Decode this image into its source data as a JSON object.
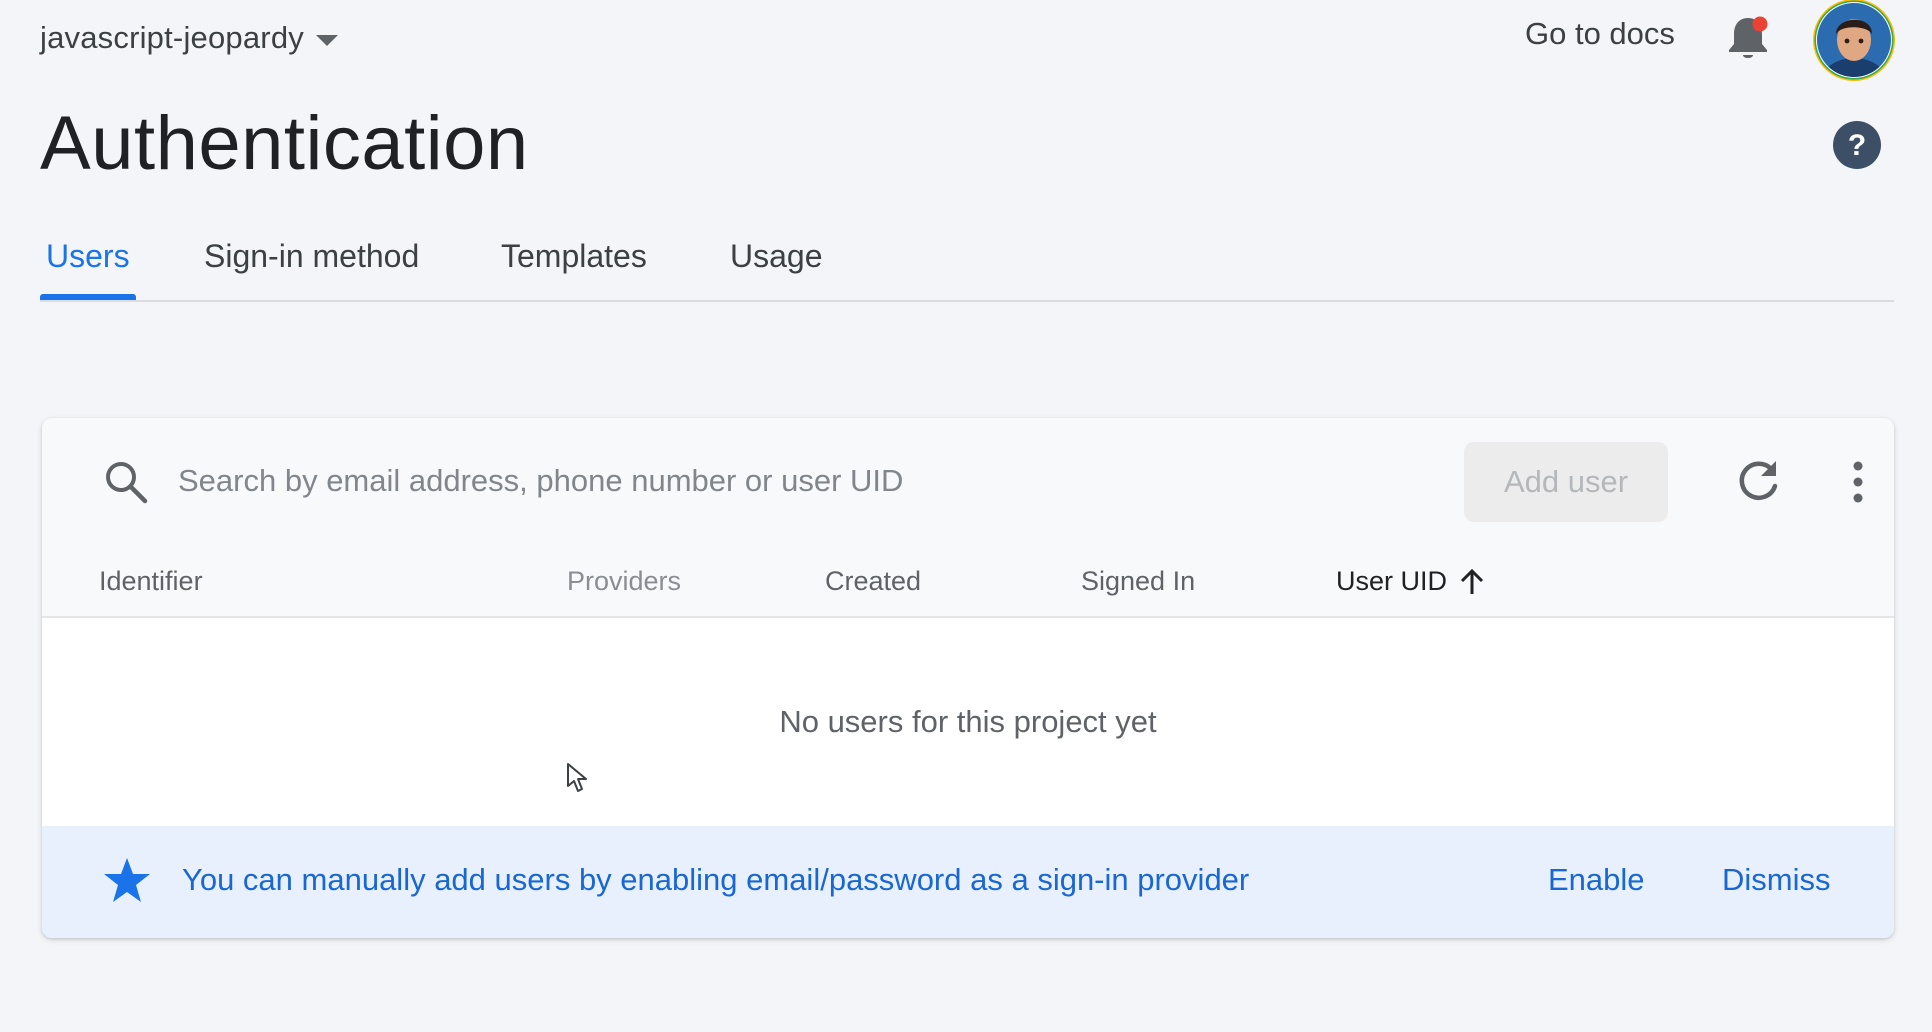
{
  "header": {
    "project_name": "javascript-jeopardy",
    "go_to_docs": "Go to docs",
    "notification_badge_color": "#ea4335"
  },
  "page": {
    "title": "Authentication"
  },
  "tabs": [
    {
      "label": "Users",
      "active": true
    },
    {
      "label": "Sign-in method",
      "active": false
    },
    {
      "label": "Templates",
      "active": false
    },
    {
      "label": "Usage",
      "active": false
    }
  ],
  "users_table": {
    "search": {
      "placeholder": "Search by email address, phone number or user UID",
      "value": ""
    },
    "add_user_label": "Add user",
    "columns": {
      "identifier": "Identifier",
      "providers": "Providers",
      "created": "Created",
      "signed_in": "Signed In",
      "user_uid": "User UID"
    },
    "sort": {
      "column": "User UID",
      "direction": "ascending"
    },
    "empty_message": "No users for this project yet"
  },
  "banner": {
    "message": "You can manually add users by enabling email/password as a sign-in provider",
    "enable_label": "Enable",
    "dismiss_label": "Dismiss"
  },
  "colors": {
    "accent": "#1a73e8",
    "banner_bg": "#e8f0fe",
    "page_bg": "#f3f5f8"
  }
}
